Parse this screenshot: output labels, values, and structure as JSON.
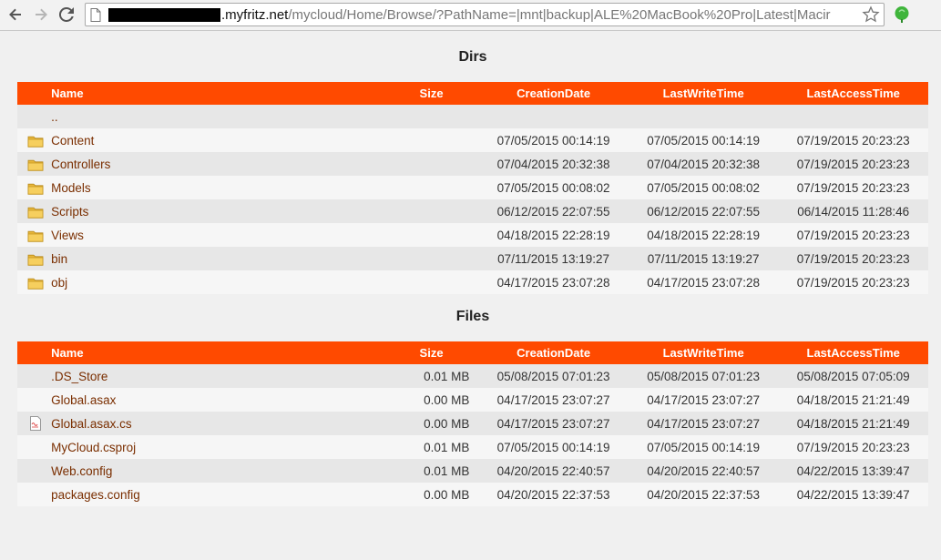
{
  "browser": {
    "url_host": ".myfritz.net",
    "url_path": "/mycloud/Home/Browse/?PathName=|mnt|backup|ALE%20MacBook%20Pro|Latest|Macir"
  },
  "dirs": {
    "title": "Dirs",
    "columns": {
      "name": "Name",
      "size": "Size",
      "created": "CreationDate",
      "written": "LastWriteTime",
      "accessed": "LastAccessTime"
    },
    "rows": [
      {
        "icon": "",
        "name": "..",
        "size": "",
        "created": "",
        "written": "",
        "accessed": ""
      },
      {
        "icon": "folder-icon",
        "name": "Content",
        "size": "",
        "created": "07/05/2015 00:14:19",
        "written": "07/05/2015 00:14:19",
        "accessed": "07/19/2015 20:23:23"
      },
      {
        "icon": "folder-icon",
        "name": "Controllers",
        "size": "",
        "created": "07/04/2015 20:32:38",
        "written": "07/04/2015 20:32:38",
        "accessed": "07/19/2015 20:23:23"
      },
      {
        "icon": "folder-icon",
        "name": "Models",
        "size": "",
        "created": "07/05/2015 00:08:02",
        "written": "07/05/2015 00:08:02",
        "accessed": "07/19/2015 20:23:23"
      },
      {
        "icon": "folder-icon",
        "name": "Scripts",
        "size": "",
        "created": "06/12/2015 22:07:55",
        "written": "06/12/2015 22:07:55",
        "accessed": "06/14/2015 11:28:46"
      },
      {
        "icon": "folder-icon",
        "name": "Views",
        "size": "",
        "created": "04/18/2015 22:28:19",
        "written": "04/18/2015 22:28:19",
        "accessed": "07/19/2015 20:23:23"
      },
      {
        "icon": "folder-icon",
        "name": "bin",
        "size": "",
        "created": "07/11/2015 13:19:27",
        "written": "07/11/2015 13:19:27",
        "accessed": "07/19/2015 20:23:23"
      },
      {
        "icon": "folder-icon",
        "name": "obj",
        "size": "",
        "created": "04/17/2015 23:07:28",
        "written": "04/17/2015 23:07:28",
        "accessed": "07/19/2015 20:23:23"
      }
    ]
  },
  "files": {
    "title": "Files",
    "columns": {
      "name": "Name",
      "size": "Size",
      "created": "CreationDate",
      "written": "LastWriteTime",
      "accessed": "LastAccessTime"
    },
    "rows": [
      {
        "icon": "",
        "name": ".DS_Store",
        "size": "0.01 MB",
        "created": "05/08/2015 07:01:23",
        "written": "05/08/2015 07:01:23",
        "accessed": "05/08/2015 07:05:09"
      },
      {
        "icon": "",
        "name": "Global.asax",
        "size": "0.00 MB",
        "created": "04/17/2015 23:07:27",
        "written": "04/17/2015 23:07:27",
        "accessed": "04/18/2015 21:21:49"
      },
      {
        "icon": "cs-file-icon",
        "name": "Global.asax.cs",
        "size": "0.00 MB",
        "created": "04/17/2015 23:07:27",
        "written": "04/17/2015 23:07:27",
        "accessed": "04/18/2015 21:21:49"
      },
      {
        "icon": "",
        "name": "MyCloud.csproj",
        "size": "0.01 MB",
        "created": "07/05/2015 00:14:19",
        "written": "07/05/2015 00:14:19",
        "accessed": "07/19/2015 20:23:23"
      },
      {
        "icon": "",
        "name": "Web.config",
        "size": "0.01 MB",
        "created": "04/20/2015 22:40:57",
        "written": "04/20/2015 22:40:57",
        "accessed": "04/22/2015 13:39:47"
      },
      {
        "icon": "",
        "name": "packages.config",
        "size": "0.00 MB",
        "created": "04/20/2015 22:37:53",
        "written": "04/20/2015 22:37:53",
        "accessed": "04/22/2015 13:39:47"
      }
    ]
  },
  "colors": {
    "header_bg": "#ff4a00",
    "link": "#7a2e00"
  }
}
